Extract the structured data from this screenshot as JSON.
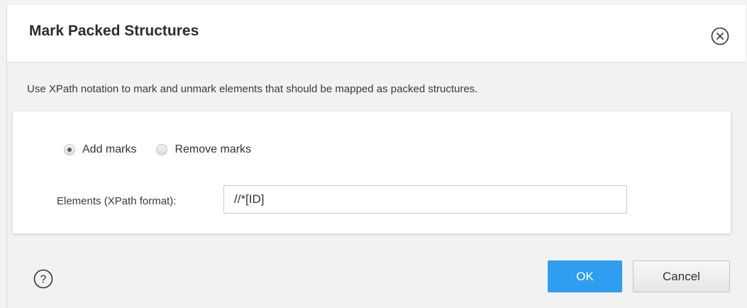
{
  "dialog": {
    "title": "Mark Packed Structures",
    "description": "Use XPath notation to mark and unmark elements that should be mapped as packed structures."
  },
  "mode": {
    "options": [
      {
        "label": "Add marks",
        "checked": true
      },
      {
        "label": "Remove marks",
        "checked": false
      }
    ]
  },
  "elements_field": {
    "label": "Elements (XPath format):",
    "value": "//*[ID]"
  },
  "footer": {
    "ok_label": "OK",
    "cancel_label": "Cancel"
  },
  "icons": {
    "close": "close-circle-icon",
    "help": "help-circle-icon"
  },
  "colors": {
    "primary_button": "#2f9ef0",
    "background": "#f2f2f2",
    "panel": "#ffffff"
  }
}
